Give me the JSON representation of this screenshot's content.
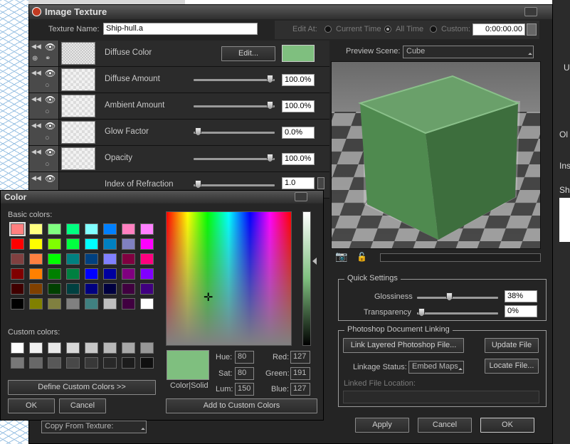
{
  "window": {
    "title": "Image Texture"
  },
  "texture_name": {
    "label": "Texture Name:",
    "value": "Ship-hull.a"
  },
  "edit_at": {
    "label": "Edit At:",
    "options": [
      "Current Time",
      "All Time",
      "Custom:"
    ],
    "selected": "All Time",
    "time_value": "0:00:00.00"
  },
  "channels": [
    {
      "label": "Diffuse Color",
      "button": "Edit...",
      "swatch": "#7fbf7f"
    },
    {
      "label": "Diffuse Amount",
      "value": "100.0%",
      "level": 1.0
    },
    {
      "label": "Ambient Amount",
      "value": "100.0%",
      "level": 1.0
    },
    {
      "label": "Glow Factor",
      "value": "0.0%",
      "level": 0.0
    },
    {
      "label": "Opacity",
      "value": "100.0%",
      "level": 1.0
    },
    {
      "label": "Index of Refraction",
      "value": "1.0",
      "level": 0.0
    }
  ],
  "preview": {
    "label": "Preview Scene:",
    "scene": "Cube"
  },
  "quick_settings": {
    "title": "Quick Settings",
    "glossiness": {
      "label": "Glossiness",
      "value": "38%",
      "level": 0.38
    },
    "transparency": {
      "label": "Transparency",
      "value": "0%",
      "level": 0.0
    }
  },
  "psd_linking": {
    "title": "Photoshop Document Linking",
    "link_button": "Link Layered Photoshop File...",
    "update_button": "Update File",
    "status_label": "Linkage Status:",
    "status_value": "Embed Maps",
    "locate_button": "Locate File...",
    "location_label": "Linked File Location:"
  },
  "bottom": {
    "copy_from": "Copy From Texture:",
    "apply": "Apply",
    "cancel": "Cancel",
    "ok": "OK"
  },
  "color_dialog": {
    "title": "Color",
    "basic_label": "Basic colors:",
    "custom_label": "Custom colors:",
    "basic_colors": [
      "#ff8080",
      "#ffff80",
      "#80ff80",
      "#00ff80",
      "#80ffff",
      "#0080ff",
      "#ff80c0",
      "#ff80ff",
      "#ff0000",
      "#ffff00",
      "#80ff00",
      "#00ff40",
      "#00ffff",
      "#0080c0",
      "#8080c0",
      "#ff00ff",
      "#804040",
      "#ff8040",
      "#00ff00",
      "#008080",
      "#004080",
      "#8080ff",
      "#800040",
      "#ff0080",
      "#800000",
      "#ff8000",
      "#008000",
      "#008040",
      "#0000ff",
      "#0000a0",
      "#800080",
      "#8000ff",
      "#400000",
      "#804000",
      "#004000",
      "#004040",
      "#000080",
      "#000040",
      "#400040",
      "#400080",
      "#000000",
      "#808000",
      "#808040",
      "#808080",
      "#408080",
      "#c0c0c0",
      "#400040",
      "#ffffff"
    ],
    "custom_colors": [
      "#ffffff",
      "#f0f0f0",
      "#e8e8e8",
      "#d8d8d8",
      "#c8c8c8",
      "#b8b8b8",
      "#a8a8a8",
      "#989898",
      "#787878",
      "#686868",
      "#585858",
      "#484848",
      "#383838",
      "#282828",
      "#1c1c1c",
      "#101010"
    ],
    "define_button": "Define Custom Colors >>",
    "ok": "OK",
    "cancel": "Cancel",
    "color_solid_label": "Color|Solid",
    "selected_color": "#7fbf7f",
    "hue_label": "Hue:",
    "hue": "80",
    "sat_label": "Sat:",
    "sat": "80",
    "lum_label": "Lum:",
    "lum": "150",
    "red_label": "Red:",
    "red": "127",
    "green_label": "Green:",
    "green": "191",
    "blue_label": "Blue:",
    "blue": "127",
    "add_button": "Add to Custom Colors"
  },
  "background_right": {
    "texts": [
      "U",
      "Ol",
      "Ins",
      "Sh"
    ]
  },
  "icons": [
    "app-logo-icon",
    "eye-icon",
    "rewind-icon",
    "camera-icon",
    "lock-icon",
    "crosshair-icon"
  ]
}
